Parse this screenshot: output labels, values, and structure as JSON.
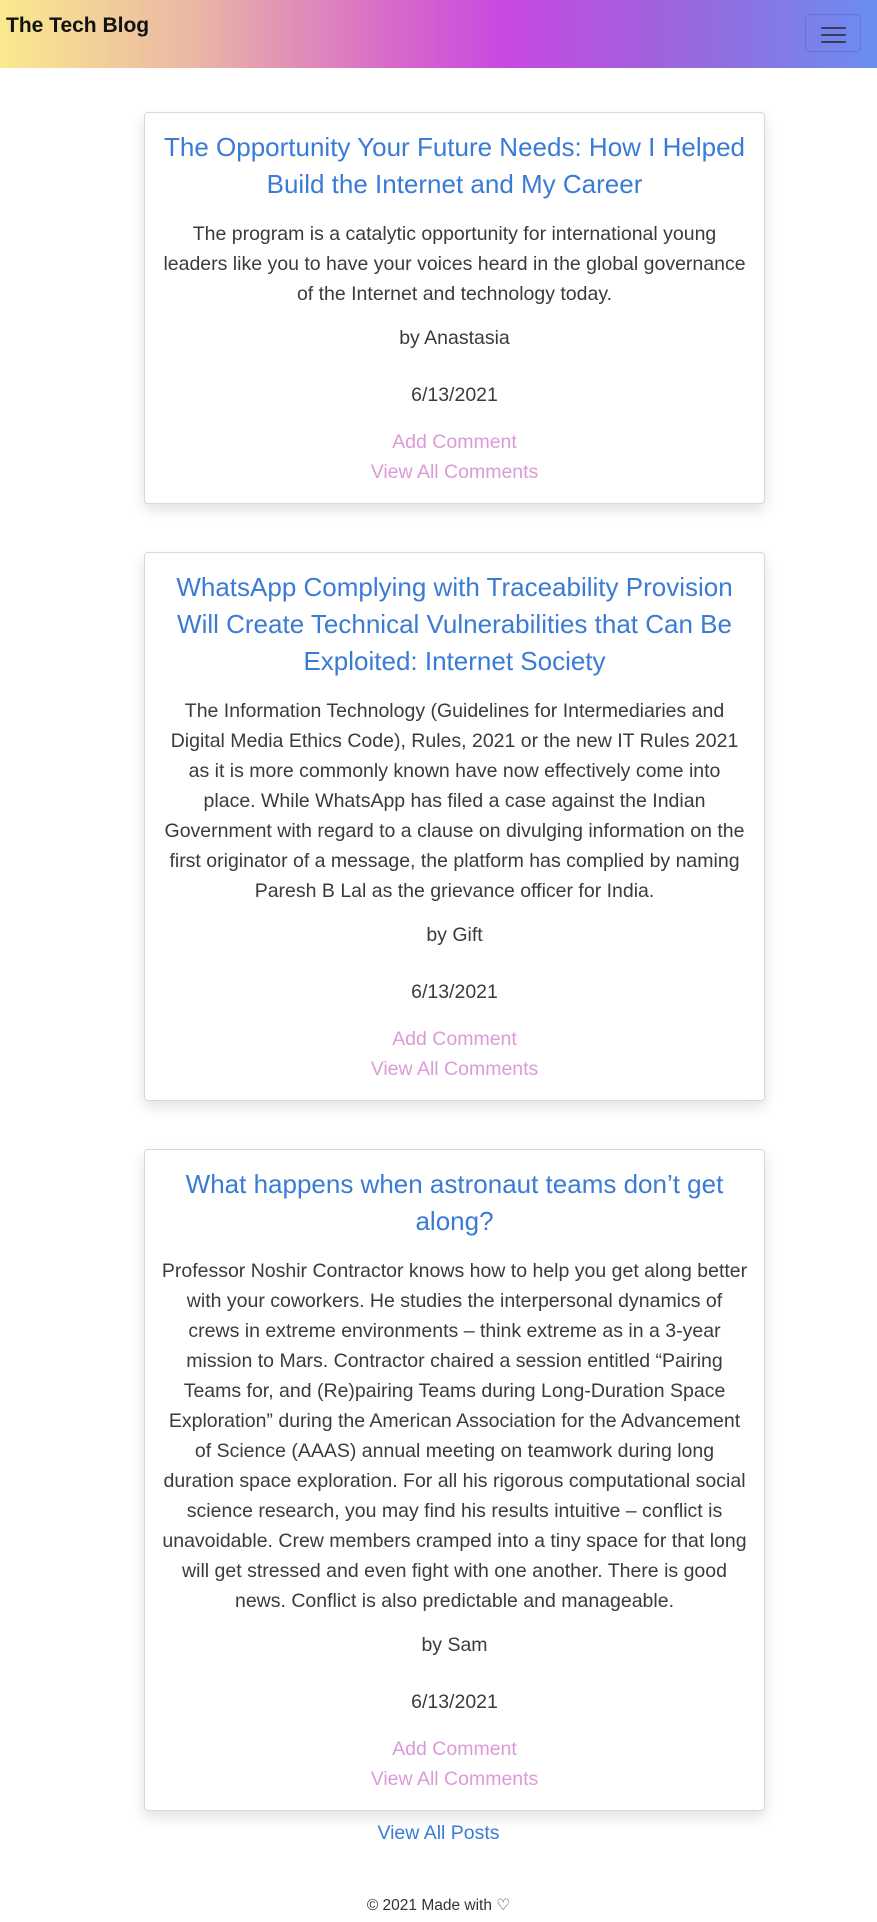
{
  "navbar": {
    "brand": "The Tech Blog",
    "menu_icon": "hamburger-menu-icon"
  },
  "posts": [
    {
      "title": "The Opportunity Your Future Needs: How I Helped Build the Internet and My Career",
      "excerpt": "The program is a catalytic opportunity for international young leaders like you to have your voices heard in the global governance of the Internet and technology today.",
      "author": "by Anastasia",
      "date": "6/13/2021",
      "add_comment": "Add Comment",
      "view_comments": "View All Comments"
    },
    {
      "title": "WhatsApp Complying with Traceability Provision Will Create Technical Vulnerabilities that Can Be Exploited: Internet Society",
      "excerpt": "The Information Technology (Guidelines for Intermediaries and Digital Media Ethics Code), Rules, 2021 or the new IT Rules 2021 as it is more commonly known have now effectively come into place. While WhatsApp has filed a case against the Indian Government with regard to a clause on divulging information on the first originator of a message, the platform has complied by naming Paresh B Lal as the grievance officer for India.",
      "author": "by Gift",
      "date": "6/13/2021",
      "add_comment": "Add Comment",
      "view_comments": "View All Comments"
    },
    {
      "title": "What happens when astronaut teams don’t get along?",
      "excerpt": "Professor Noshir Contractor knows how to help you get along better with your coworkers. He studies the interpersonal dynamics of crews in extreme environments – think extreme as in a 3-year mission to Mars. Contractor chaired a session entitled “Pairing Teams for, and (Re)pairing Teams during Long-Duration Space Exploration” during the American Association for the Advancement of Science (AAAS) annual meeting on teamwork during long duration space exploration. For all his rigorous computational social science research, you may find his results intuitive – conflict is unavoidable. Crew members cramped into a tiny space for that long will get stressed and even fight with one another. There is good news. Conflict is also predictable and manageable.",
      "author": "by Sam",
      "date": "6/13/2021",
      "add_comment": "Add Comment",
      "view_comments": "View All Comments"
    }
  ],
  "view_all_posts": "View All Posts",
  "footer": {
    "text": "© 2021 Made with ♡"
  },
  "colors": {
    "link_blue": "#3a7bd5",
    "comment_pink": "#dc9ad9"
  }
}
